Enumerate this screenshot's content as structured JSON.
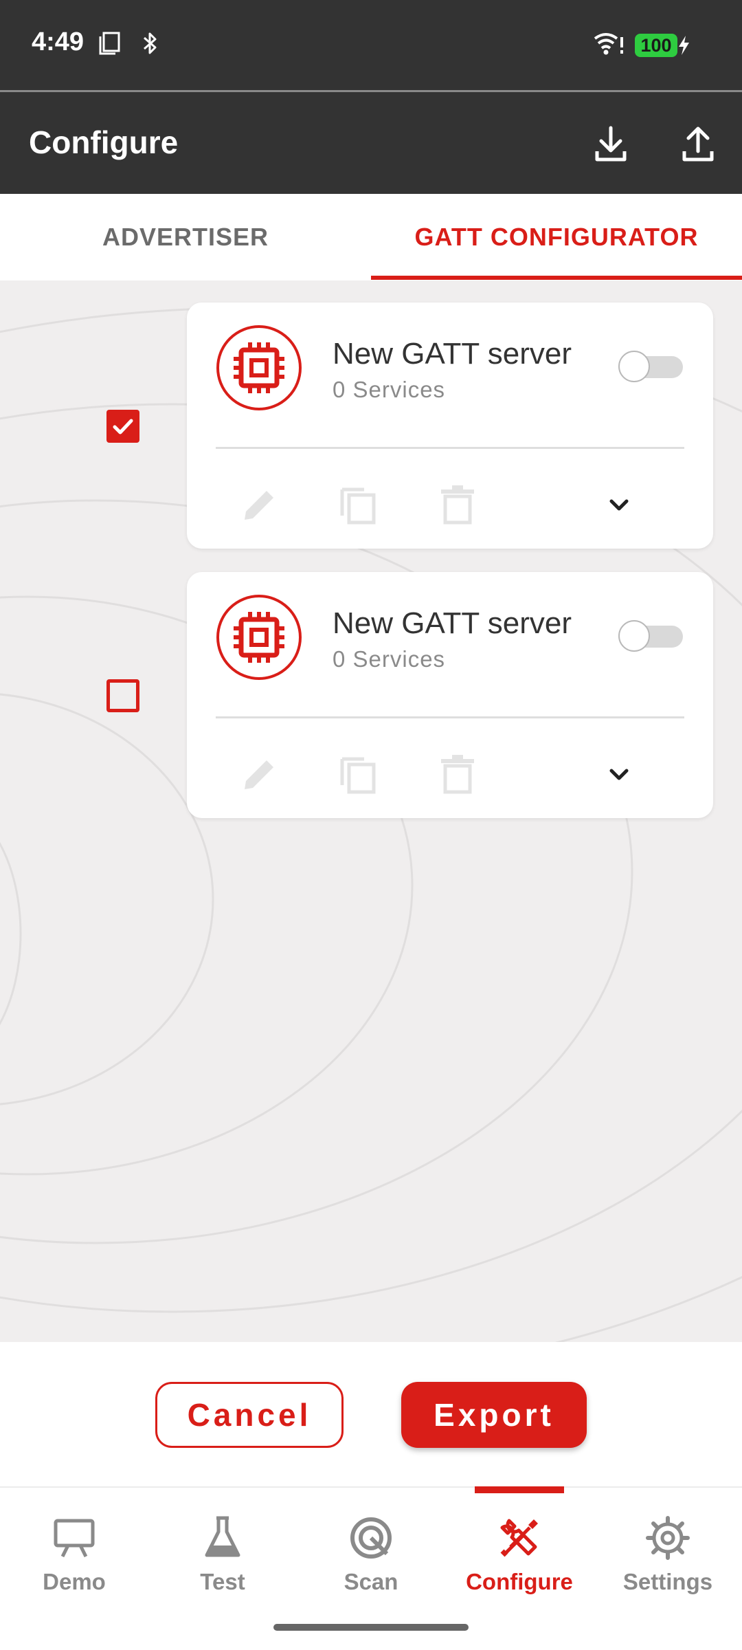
{
  "status_bar": {
    "time": "4:49",
    "battery": "100"
  },
  "app_bar": {
    "title": "Configure"
  },
  "tabs": [
    {
      "label": "ADVERTISER",
      "active": false
    },
    {
      "label": "GATT CONFIGURATOR",
      "active": true
    }
  ],
  "servers": [
    {
      "name": "New GATT server",
      "services": "0 Services",
      "selected": true,
      "enabled": false
    },
    {
      "name": "New GATT server",
      "services": "0 Services",
      "selected": false,
      "enabled": false
    }
  ],
  "actions": {
    "cancel_label": "Cancel",
    "export_label": "Export"
  },
  "nav": [
    {
      "label": "Demo",
      "icon": "presentation-board-icon"
    },
    {
      "label": "Test",
      "icon": "flask-icon"
    },
    {
      "label": "Scan",
      "icon": "radar-scan-icon"
    },
    {
      "label": "Configure",
      "icon": "wrench-screwdriver-icon",
      "active": true
    },
    {
      "label": "Settings",
      "icon": "gear-icon"
    }
  ],
  "colors": {
    "accent": "#d91e18",
    "bar": "#333333",
    "content_bg": "#f0eeee"
  }
}
